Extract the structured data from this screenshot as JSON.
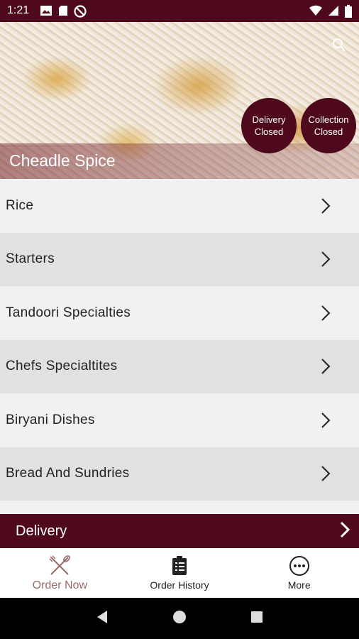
{
  "status_bar": {
    "time": "1:21"
  },
  "header": {
    "restaurant_name": "Cheadle Spice",
    "delivery_status": {
      "line1": "Delivery",
      "line2": "Closed"
    },
    "collection_status": {
      "line1": "Collection",
      "line2": "Closed"
    }
  },
  "menu": {
    "categories": [
      {
        "label": "Rice"
      },
      {
        "label": "Starters"
      },
      {
        "label": "Tandoori Specialties"
      },
      {
        "label": "Chefs Specialtites"
      },
      {
        "label": "Biryani Dishes"
      },
      {
        "label": "Bread And Sundries"
      }
    ]
  },
  "order_mode_bar": {
    "label": "Delivery"
  },
  "tabs": [
    {
      "label": "Order Now",
      "icon": "fork-knife-icon",
      "active": true
    },
    {
      "label": "Order History",
      "icon": "clipboard-icon",
      "active": false
    },
    {
      "label": "More",
      "icon": "more-icon",
      "active": false
    }
  ],
  "colors": {
    "brand": "#4e0a1c",
    "active_tab": "#9a6a6a"
  }
}
